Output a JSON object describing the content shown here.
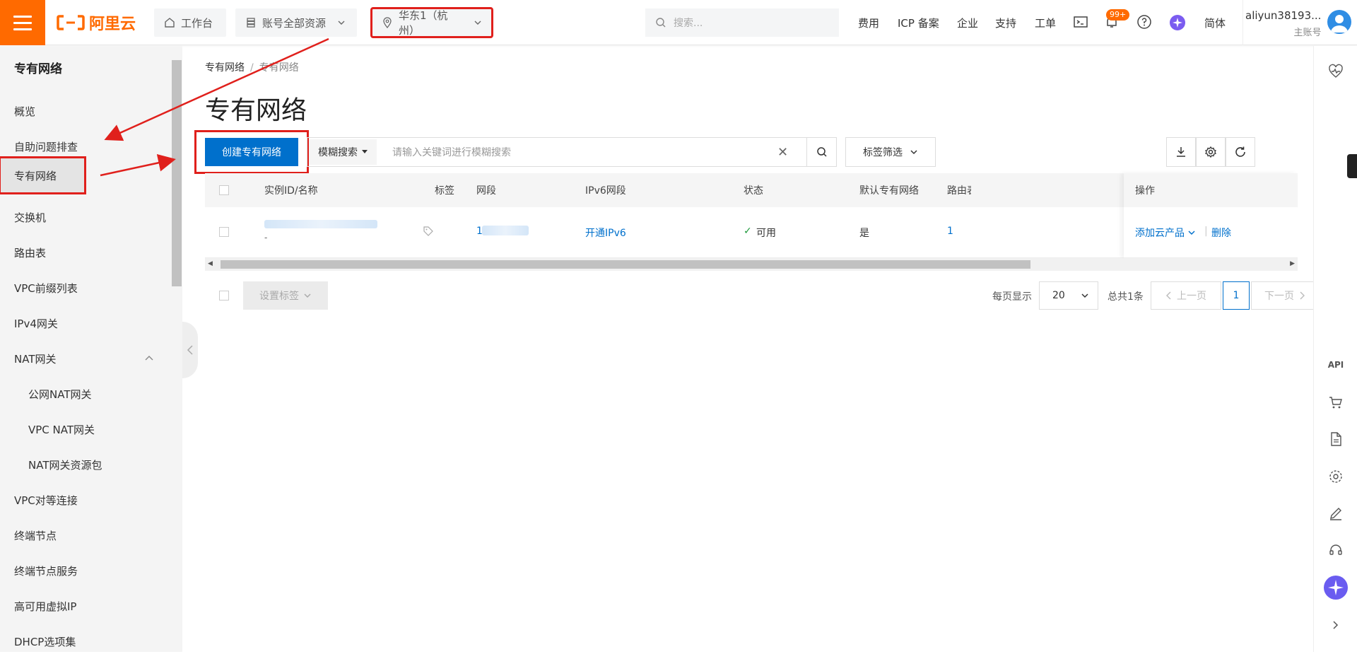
{
  "topbar": {
    "logo_text": "阿里云",
    "workbench": "工作台",
    "resources": "账号全部资源",
    "region": "华东1（杭州）",
    "search_placeholder": "搜索...",
    "links": [
      "费用",
      "ICP 备案",
      "企业",
      "支持",
      "工单"
    ],
    "badge": "99+",
    "lang": "简体",
    "user_name": "aliyun38193...",
    "user_sub": "主账号"
  },
  "sidebar": {
    "title": "专有网络",
    "items": [
      {
        "label": "概览"
      },
      {
        "label": "自助问题排查"
      },
      {
        "label": "专有网络"
      },
      {
        "label": "交换机"
      },
      {
        "label": "路由表"
      },
      {
        "label": "VPC前缀列表"
      },
      {
        "label": "IPv4网关"
      },
      {
        "label": "NAT网关"
      },
      {
        "label": "公网NAT网关"
      },
      {
        "label": "VPC NAT网关"
      },
      {
        "label": "NAT网关资源包"
      },
      {
        "label": "VPC对等连接"
      },
      {
        "label": "终端节点"
      },
      {
        "label": "终端节点服务"
      },
      {
        "label": "高可用虚拟IP"
      },
      {
        "label": "DHCP选项集"
      }
    ]
  },
  "main": {
    "breadcrumb": [
      "专有网络",
      "专有网络"
    ],
    "title": "专有网络",
    "create_button": "创建专有网络",
    "fuzzy_label": "模糊搜索",
    "search_placeholder": "请输入关键词进行模糊搜索",
    "tag_filter": "标签筛选",
    "columns": [
      "实例ID/名称",
      "标签",
      "网段",
      "IPv6网段",
      "状态",
      "默认专有网络",
      "路由表",
      "操作"
    ],
    "row": {
      "id_suffix": "-",
      "cidr_prefix": "1",
      "ipv6": "开通IPv6",
      "status": "可用",
      "default": "是",
      "route_count": "1",
      "add_product": "添加云产品",
      "delete": "删除"
    },
    "set_tag": "设置标签",
    "per_page_label": "每页显示",
    "per_page": "20",
    "total": "总共1条",
    "prev": "上一页",
    "next": "下一页",
    "page": "1"
  },
  "rightbar": {
    "api_label": "API"
  },
  "colors": {
    "brand": "#ff6a00",
    "primary": "#0070cc",
    "highlight": "#e0201c"
  }
}
